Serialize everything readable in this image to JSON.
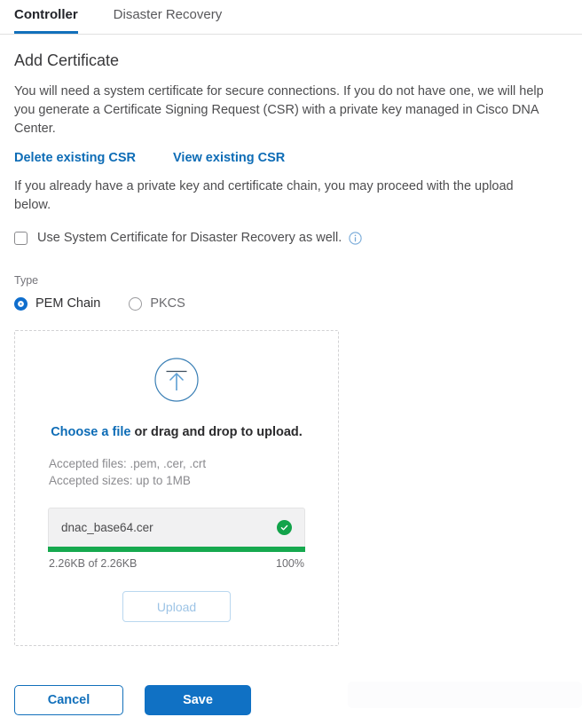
{
  "tabs": [
    {
      "label": "Controller",
      "active": true
    },
    {
      "label": "Disaster Recovery",
      "active": false
    }
  ],
  "page": {
    "title": "Add Certificate",
    "intro": "You will need a system certificate for secure connections. If you do not have one, we will help you generate a Certificate Signing Request (CSR) with a private key managed in Cisco DNA Center.",
    "delete_csr_link": "Delete existing CSR",
    "view_csr_link": "View existing CSR",
    "paragraph2": "If you already have a private key and certificate chain, you may proceed with the upload below."
  },
  "checkbox": {
    "label": "Use System Certificate for Disaster Recovery as well.",
    "checked": false,
    "info_icon": "info-icon"
  },
  "type_section": {
    "label": "Type",
    "options": [
      {
        "label": "PEM Chain",
        "selected": true
      },
      {
        "label": "PKCS",
        "selected": false
      }
    ]
  },
  "dropzone": {
    "icon": "upload-arrow-circle-icon",
    "choose_link": "Choose a file",
    "drop_text": " or drag and drop to upload.",
    "accepted_files": "Accepted files: .pem, .cer, .crt",
    "accepted_sizes": "Accepted sizes: up to 1MB",
    "file": {
      "name": "dnac_base64.cer",
      "status_icon": "check-circle-icon",
      "progress_text": "2.26KB of 2.26KB",
      "percent": "100%",
      "progress_value": 100
    },
    "upload_button": "Upload"
  },
  "footer": {
    "cancel_label": "Cancel",
    "save_label": "Save"
  },
  "colors": {
    "accent_blue": "#1270bb",
    "link_blue": "#0d6cb6",
    "success_green": "#16a94f",
    "save_button": "#1071c4"
  }
}
